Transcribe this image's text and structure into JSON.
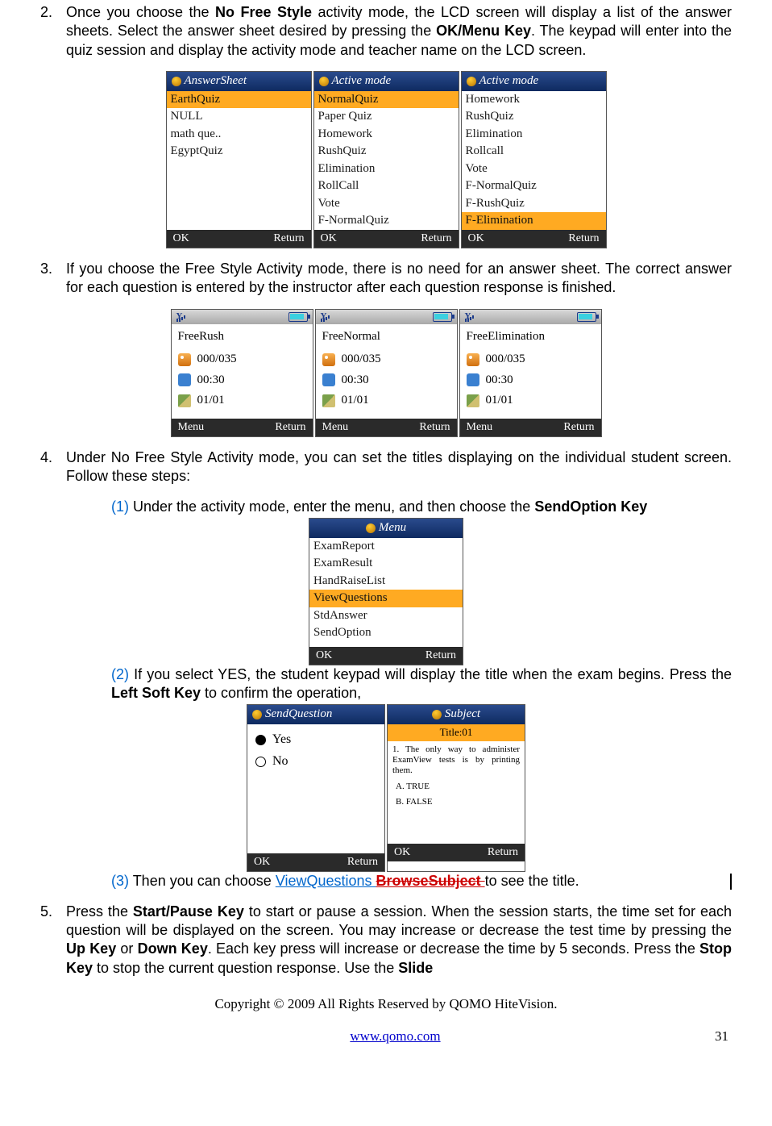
{
  "item2": {
    "num": "2.",
    "text_a": "Once you choose the ",
    "bold_a": "No Free Style",
    "text_b": " activity mode, the LCD screen will display a list of the answer sheets. Select the answer sheet desired by pressing the ",
    "bold_b": "OK/Menu Key",
    "text_c": ". The keypad will enter into the quiz session and display the activity mode and teacher name on the LCD screen."
  },
  "screens_a": {
    "s1": {
      "title": "AnswerSheet",
      "items": [
        "EarthQuiz",
        "NULL",
        "math que..",
        "EgyptQuiz"
      ],
      "selected": 0,
      "ok": "OK",
      "ret": "Return"
    },
    "s2": {
      "title": "Active mode",
      "items": [
        "NormalQuiz",
        "Paper Quiz",
        "Homework",
        "RushQuiz",
        "Elimination",
        "RollCall",
        "Vote",
        "F-NormalQuiz"
      ],
      "selected": 0,
      "ok": "OK",
      "ret": "Return"
    },
    "s3": {
      "title": "Active mode",
      "items": [
        "Homework",
        "RushQuiz",
        "Elimination",
        "Rollcall",
        "Vote",
        "F-NormalQuiz",
        "F-RushQuiz",
        "F-Elimination"
      ],
      "selected": 7,
      "ok": "OK",
      "ret": "Return"
    }
  },
  "item3": {
    "num": "3.",
    "text": "If you choose the Free Style Activity mode, there is no need for an answer sheet. The correct answer for each question is entered by the instructor after each question response is finished."
  },
  "screens_b": {
    "s1": {
      "title": "FreeRush",
      "count": "000/035",
      "time": "00:30",
      "q": "01/01",
      "menu": "Menu",
      "ret": "Return"
    },
    "s2": {
      "title": "FreeNormal",
      "count": "000/035",
      "time": "00:30",
      "q": "01/01",
      "menu": "Menu",
      "ret": "Return"
    },
    "s3": {
      "title": "FreeElimination",
      "count": "000/035",
      "time": "00:30",
      "q": "01/01",
      "menu": "Menu",
      "ret": "Return"
    }
  },
  "item4": {
    "num": "4.",
    "text": "Under No Free Style Activity mode, you can set the titles displaying on the individual student screen. Follow these steps:"
  },
  "sub1": {
    "num": "(1) ",
    "text_a": "Under the activity mode, enter the menu, and then choose the ",
    "bold": "SendOption Key"
  },
  "menu_screen": {
    "title": "Menu",
    "items": [
      "ExamReport",
      "ExamResult",
      "HandRaiseList",
      "ViewQuestions",
      "StdAnswer",
      "SendOption"
    ],
    "selected": 3,
    "ok": "OK",
    "ret": "Return"
  },
  "sub2": {
    "num": "(2) ",
    "text_a": "If you select YES, the student keypad will display the title when the exam begins. Press the ",
    "bold": "Left Soft Key",
    "text_b": " to confirm the operation,"
  },
  "sendq": {
    "title": "SendQuestion",
    "yes": "Yes",
    "no": "No",
    "ok": "OK",
    "ret": "Return"
  },
  "subject": {
    "titlebar": "Subject",
    "title": "Title:01",
    "qtext": "1. The only way to administer ExamView tests is by printing them.",
    "a": "A. TRUE",
    "b": "B. FALSE",
    "ok": "OK",
    "ret": "Return"
  },
  "sub3": {
    "num": "(3) ",
    "text_a": "Then you can choose ",
    "link": "ViewQuestions ",
    "strike": "BrowseSubject ",
    "text_b": "to see the title."
  },
  "item5": {
    "num": "5.",
    "text_a": "Press the ",
    "b1": "Start/Pause Key",
    "text_b": " to start or pause a session. When the session starts, the time set for each question will be displayed on the screen. You may increase or decrease the test time by pressing the ",
    "b2": "Up Key",
    "text_c": " or ",
    "b3": "Down Key",
    "text_d": ". Each key press will increase or decrease the time by 5 seconds. Press the ",
    "b4": "Stop Key",
    "text_e": " to stop the current question response. Use the ",
    "b5": "Slide"
  },
  "copyright": "Copyright © 2009 All Rights Reserved by QOMO HiteVision.",
  "url": "www.qomo.com",
  "page": "31"
}
